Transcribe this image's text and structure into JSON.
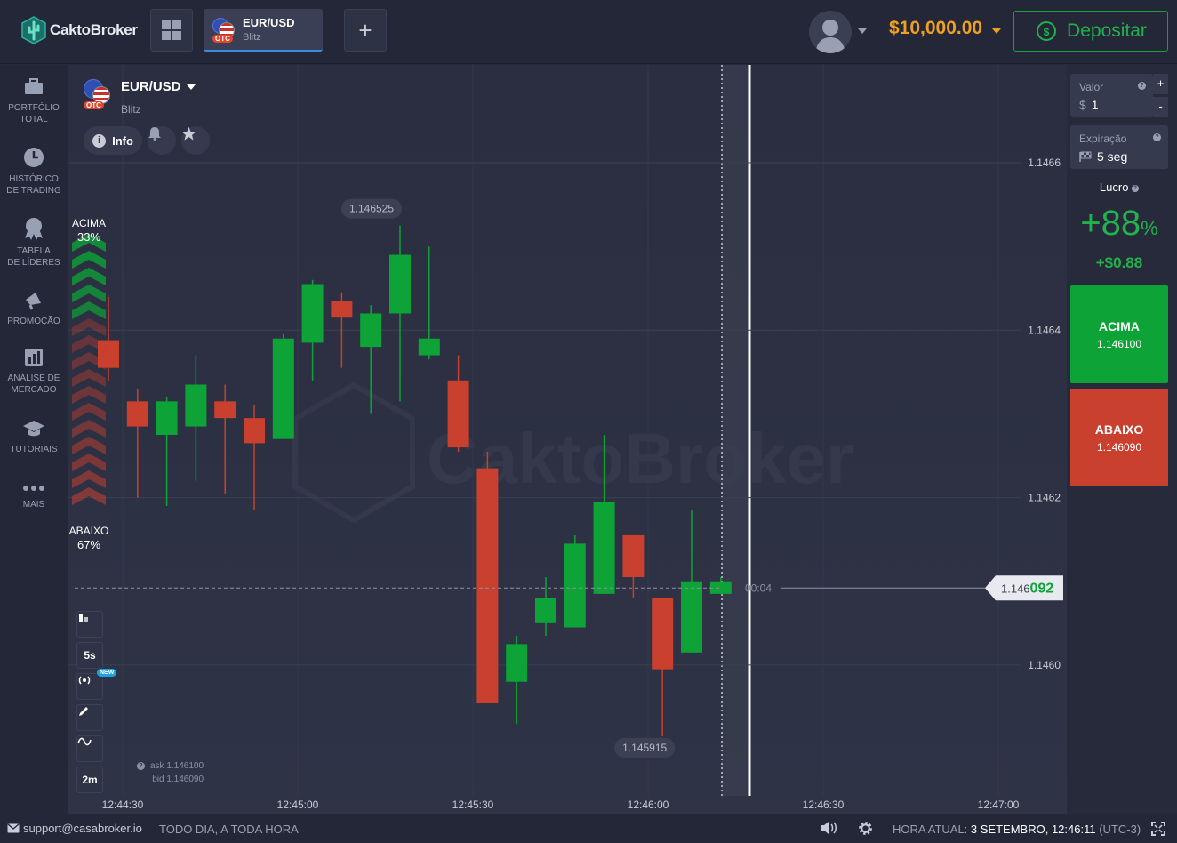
{
  "brand": {
    "name": "CaktoBroker",
    "watermark": "CaktoBroker"
  },
  "topbar": {
    "asset_tab": {
      "pair": "EUR/USD",
      "mode": "Blitz",
      "badge": "OTC"
    },
    "add_label": "+",
    "balance": "$10,000.00",
    "deposit_label": "Depositar"
  },
  "sidebar": {
    "items": [
      {
        "label1": "PORTFÓLIO",
        "label2": "TOTAL",
        "icon": "briefcase-icon"
      },
      {
        "label1": "HISTÓRICO",
        "label2": "DE TRADING",
        "icon": "clock-icon"
      },
      {
        "label1": "TABELA",
        "label2": "DE LÍDERES",
        "icon": "medal-icon"
      },
      {
        "label1": "PROMOÇÃO",
        "label2": "",
        "icon": "megaphone-icon"
      },
      {
        "label1": "ANÁLISE DE",
        "label2": "MERCADO",
        "icon": "bar-chart-icon"
      },
      {
        "label1": "TUTORIAIS",
        "label2": "",
        "icon": "graduation-cap-icon"
      },
      {
        "label1": "MAIS",
        "label2": "",
        "icon": "more-dots-icon"
      }
    ]
  },
  "chart_header": {
    "pair": "EUR/USD",
    "mode": "Blitz",
    "badge": "OTC",
    "info_label": "Info"
  },
  "sentiment": {
    "up_label": "ACIMA",
    "up_pct": "33%",
    "down_label": "ABAIXO",
    "down_pct": "67%"
  },
  "tools": {
    "timeframe": "5s",
    "zoom": "2m",
    "new_badge": "NEW"
  },
  "quotes": {
    "ask": "ask 1.146100",
    "bid": "bid 1.146090"
  },
  "chart_data": {
    "type": "candlestick",
    "ylim": [
      1.14587,
      1.14676
    ],
    "y_ticks": [
      1.1466,
      1.1464,
      1.1462,
      1.146
    ],
    "y_tick_labels": [
      "1.1466",
      "1.1464",
      "1.1462",
      "1.1460"
    ],
    "x_tick_labels": [
      "12:44:30",
      "12:45:00",
      "12:45:30",
      "12:46:00",
      "12:46:30",
      "12:47:00"
    ],
    "candles": [
      {
        "o": 1.146388,
        "c": 1.146355,
        "h": 1.14644,
        "l": 1.14634
      },
      {
        "o": 1.146315,
        "c": 1.146285,
        "h": 1.14633,
        "l": 1.1462
      },
      {
        "o": 1.146275,
        "c": 1.146315,
        "h": 1.14632,
        "l": 1.14619
      },
      {
        "o": 1.146285,
        "c": 1.146335,
        "h": 1.14637,
        "l": 1.14622
      },
      {
        "o": 1.146315,
        "c": 1.146295,
        "h": 1.146335,
        "l": 1.146205
      },
      {
        "o": 1.146295,
        "c": 1.146265,
        "h": 1.14631,
        "l": 1.146185
      },
      {
        "o": 1.14627,
        "c": 1.14639,
        "h": 1.146395,
        "l": 1.14627
      },
      {
        "o": 1.146385,
        "c": 1.146455,
        "h": 1.14646,
        "l": 1.14634
      },
      {
        "o": 1.146435,
        "c": 1.146415,
        "h": 1.146445,
        "l": 1.146355
      },
      {
        "o": 1.14638,
        "c": 1.14642,
        "h": 1.14643,
        "l": 1.1463
      },
      {
        "o": 1.14642,
        "c": 1.14649,
        "h": 1.146525,
        "l": 1.146315
      },
      {
        "o": 1.14637,
        "c": 1.14639,
        "h": 1.1465,
        "l": 1.146365
      },
      {
        "o": 1.14634,
        "c": 1.14626,
        "h": 1.14637,
        "l": 1.146255
      },
      {
        "o": 1.146235,
        "c": 1.145955,
        "h": 1.146255,
        "l": 1.145955
      },
      {
        "o": 1.14598,
        "c": 1.146025,
        "h": 1.146035,
        "l": 1.14593
      },
      {
        "o": 1.14605,
        "c": 1.14608,
        "h": 1.146105,
        "l": 1.146035
      },
      {
        "o": 1.146045,
        "c": 1.146145,
        "h": 1.146155,
        "l": 1.146045
      },
      {
        "o": 1.146085,
        "c": 1.146195,
        "h": 1.146275,
        "l": 1.146085
      },
      {
        "o": 1.146155,
        "c": 1.146105,
        "h": 1.146155,
        "l": 1.14608
      },
      {
        "o": 1.14608,
        "c": 1.145995,
        "h": 1.14608,
        "l": 1.145915
      },
      {
        "o": 1.146015,
        "c": 1.1461,
        "h": 1.146185,
        "l": 1.146015
      },
      {
        "o": 1.146085,
        "c": 1.1461,
        "h": 1.146105,
        "l": 1.146085
      }
    ],
    "high_label": "1.146525",
    "low_label": "1.145915",
    "current_price_prefix": "1.146",
    "current_price_suffix": "092",
    "current_price": 1.146092,
    "countdown": "00:04"
  },
  "trade_panel": {
    "amount_label": "Valor",
    "amount_currency": "$",
    "amount_value": "1",
    "expiry_label": "Expiração",
    "expiry_value": "5 seg",
    "profit_label": "Lucro",
    "profit_pct": "+88",
    "profit_pct_sign": "%",
    "profit_amount": "+$0.88",
    "up_label": "ACIMA",
    "up_price": "1.146100",
    "down_label": "ABAIXO",
    "down_price": "1.146090"
  },
  "footer": {
    "email": "support@casabroker.io",
    "tagline": "TODO DIA, A TODA HORA",
    "time_label": "HORA ATUAL:",
    "time_value": "3 SETEMBRO, 12:46:11",
    "timezone": "(UTC-3)"
  },
  "colors": {
    "up": "#0da337",
    "down": "#c9402e",
    "accent": "#f0a020",
    "link": "#3b8be0"
  }
}
